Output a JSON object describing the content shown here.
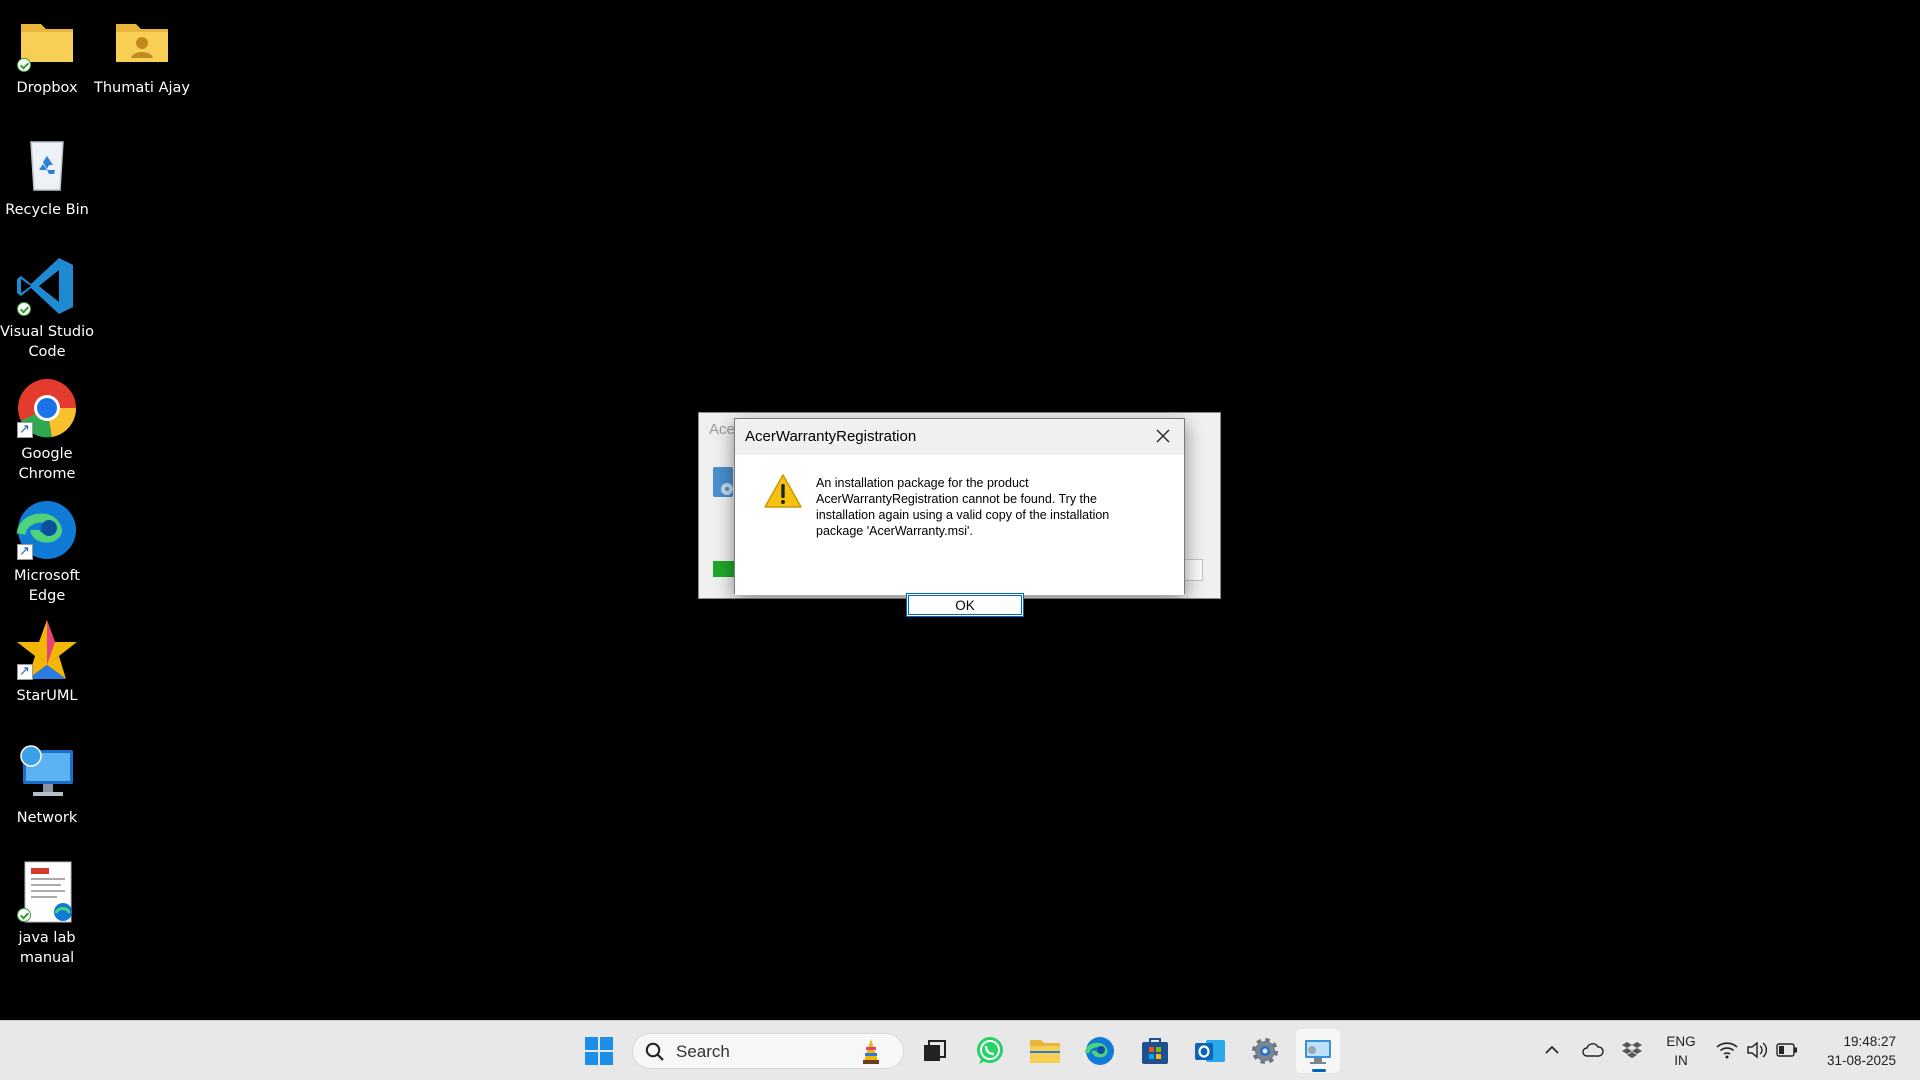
{
  "desktop": {
    "icons": [
      {
        "label": "Dropbox"
      },
      {
        "label": "Thumati Ajay"
      },
      {
        "label": "Recycle Bin"
      },
      {
        "label": "Visual Studio Code"
      },
      {
        "label": "Google Chrome"
      },
      {
        "label": "Microsoft Edge"
      },
      {
        "label": "StarUML"
      },
      {
        "label": "Network"
      },
      {
        "label": "java lab manual"
      }
    ]
  },
  "background_window": {
    "title": "Ace"
  },
  "dialog": {
    "title": "AcerWarrantyRegistration",
    "message": "An installation package for the product AcerWarrantyRegistration cannot be found. Try the installation again using a valid copy of the installation package 'AcerWarranty.msi'.",
    "icon": "warning-icon",
    "ok_label": "OK"
  },
  "taskbar": {
    "search_placeholder": "Search",
    "apps": [
      "start-icon",
      "task-view-icon",
      "whatsapp-icon",
      "file-explorer-icon",
      "edge-icon",
      "microsoft-store-icon",
      "outlook-icon",
      "settings-icon",
      "installer-icon"
    ],
    "tray": {
      "lang_line1": "ENG",
      "lang_line2": "IN",
      "time": "19:48:27",
      "date": "31-08-2025"
    }
  },
  "colors": {
    "accent": "#0067c0",
    "taskbar_bg": "#e8e8e8",
    "desktop_bg": "#000000",
    "warning": "#f5c211"
  }
}
